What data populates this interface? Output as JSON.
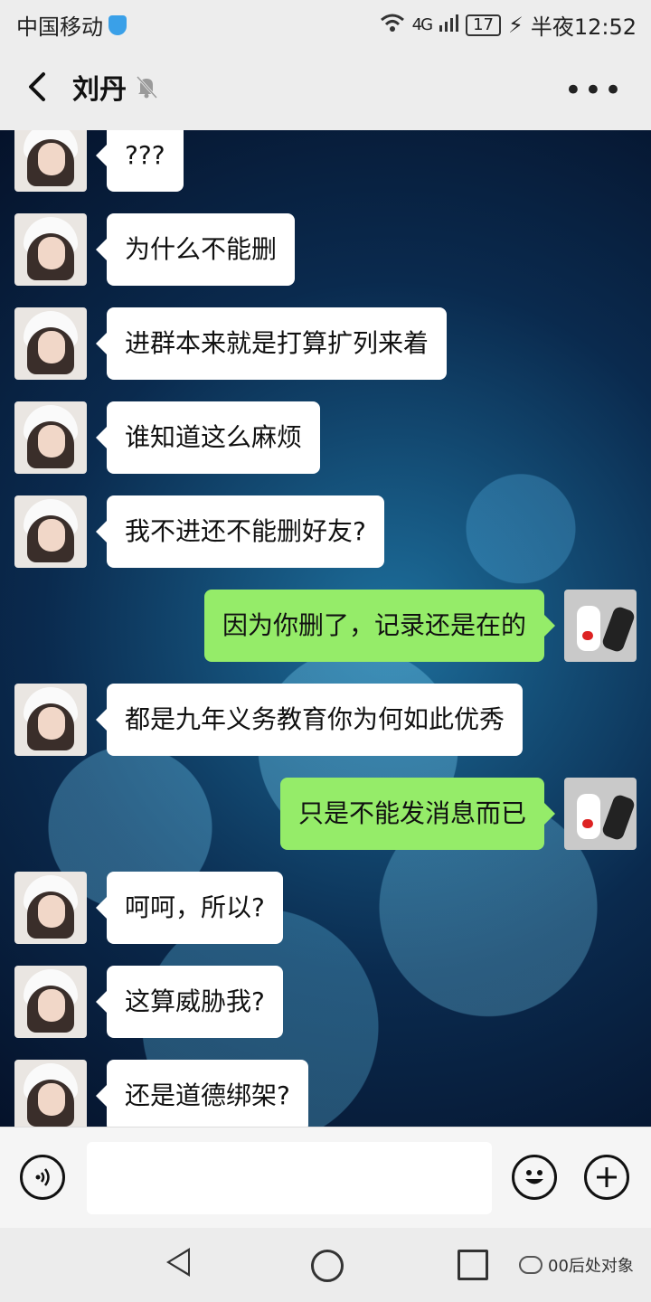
{
  "status_bar": {
    "carrier": "中国移动",
    "network": "4G",
    "battery": "17",
    "time": "半夜12:52"
  },
  "header": {
    "title": "刘丹"
  },
  "messages": [
    {
      "side": "left",
      "text": "???"
    },
    {
      "side": "left",
      "text": "为什么不能删"
    },
    {
      "side": "left",
      "text": "进群本来就是打算扩列来着"
    },
    {
      "side": "left",
      "text": "谁知道这么麻烦"
    },
    {
      "side": "left",
      "text": "我不进还不能删好友?"
    },
    {
      "side": "right",
      "text": "因为你删了，记录还是在的"
    },
    {
      "side": "left",
      "text": "都是九年义务教育你为何如此优秀"
    },
    {
      "side": "right",
      "text": "只是不能发消息而已"
    },
    {
      "side": "left",
      "text": "呵呵，所以?"
    },
    {
      "side": "left",
      "text": "这算威胁我?"
    },
    {
      "side": "left",
      "text": "还是道德绑架?"
    }
  ],
  "input_bar": {
    "value": ""
  },
  "watermark": "00后处对象",
  "colors": {
    "my_bubble": "#95ec69",
    "their_bubble": "#ffffff",
    "chrome": "#ededed"
  }
}
